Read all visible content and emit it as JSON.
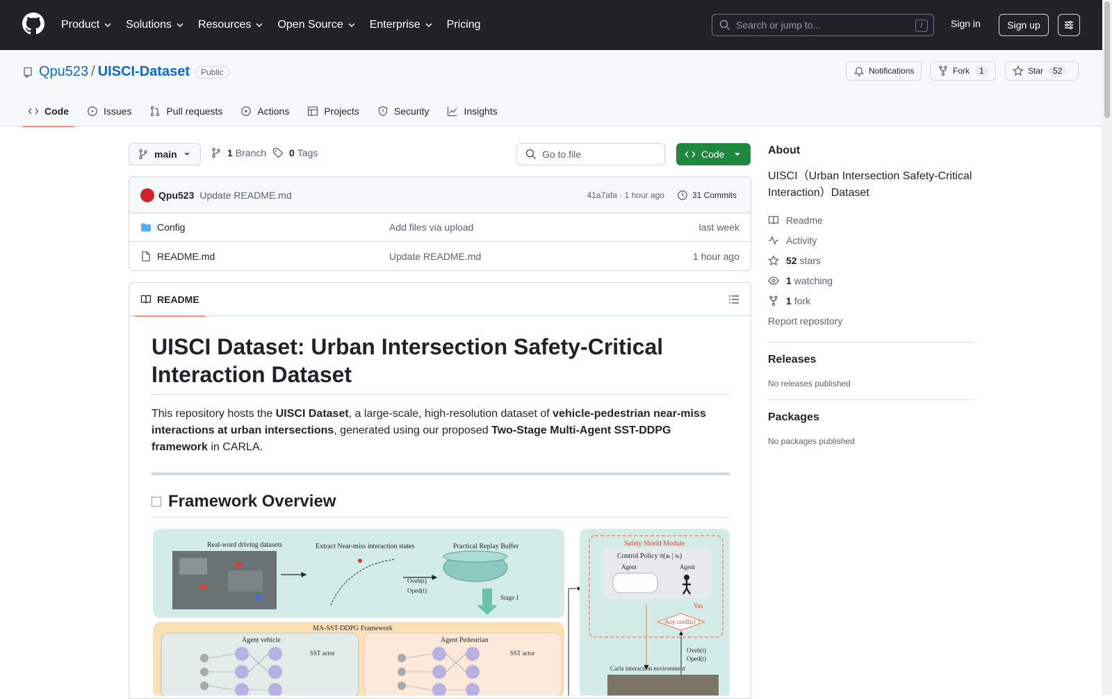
{
  "nav": {
    "items": [
      "Product",
      "Solutions",
      "Resources",
      "Open Source",
      "Enterprise",
      "Pricing"
    ],
    "search_placeholder": "Search or jump to...",
    "search_key": "/",
    "sign_in": "Sign in",
    "sign_up": "Sign up"
  },
  "repo": {
    "owner": "Qpu523",
    "sep": "/",
    "name": "UISCI-Dataset",
    "visibility": "Public",
    "notifications": "Notifications",
    "fork_label": "Fork",
    "fork_count": "1",
    "star_label": "Star",
    "star_count": "52"
  },
  "tabs": [
    "Code",
    "Issues",
    "Pull requests",
    "Actions",
    "Projects",
    "Security",
    "Insights"
  ],
  "toolbar": {
    "branch": "main",
    "branch_count": "1",
    "branch_label": "Branch",
    "tag_count": "0",
    "tag_label": "Tags",
    "goto_placeholder": "Go to file",
    "code_label": "Code"
  },
  "commit": {
    "author": "Qpu523",
    "message": "Update README.md",
    "hash_time": "41a7afa · 1 hour ago",
    "commits": "31 Commits"
  },
  "files": [
    {
      "name": "Config",
      "message": "Add files via upload",
      "date": "last week",
      "type": "folder"
    },
    {
      "name": "README.md",
      "message": "Update README.md",
      "date": "1 hour ago",
      "type": "file"
    }
  ],
  "readme": {
    "tab": "README",
    "title": "UISCI Dataset: Urban Intersection Safety-Critical Interaction Dataset",
    "p_1": "This repository hosts the ",
    "p_2": "UISCI Dataset",
    "p_3": ", a large-scale, high-resolution dataset of ",
    "p_4": "vehicle-pedestrian near-miss interactions at urban intersections",
    "p_5": ", generated using our proposed ",
    "p_6": "Two-Stage Multi-Agent SST-DDPG framework",
    "p_7": " in CARLA.",
    "h2": "Framework Overview",
    "fig": {
      "real_world": "Real-word driving datasets",
      "extract": "Extract Near-miss interaction states",
      "buffer": "Practical Replay Buffer",
      "stage1": "Stage 1",
      "framework": "MA-SST-DDPG Framework",
      "agent_vehicle": "Agent vehicle",
      "agent_ped": "Agent Pedestrian",
      "sst_actor": "SST actor",
      "shield": "Safety Shield Module",
      "policy": "Control Policy π(aₜ | sₜ)",
      "agent": "Agent",
      "conflict": "Any conflict ?",
      "yes": "Yes",
      "carla": "Carla interaction environment",
      "o_veh": "Oveh(t)",
      "o_ped": "Oped(t)"
    }
  },
  "about": {
    "heading": "About",
    "description": "UISCI（Urban Intersection Safety-Critical Interaction）Dataset",
    "readme": "Readme",
    "activity": "Activity",
    "stars_count": "52",
    "stars_label": "stars",
    "watching_count": "1",
    "watching_label": "watching",
    "fork_count": "1",
    "fork_label": "fork",
    "report": "Report repository"
  },
  "releases": {
    "heading": "Releases",
    "empty": "No releases published"
  },
  "packages": {
    "heading": "Packages",
    "empty": "No packages published"
  },
  "colors": {
    "accent": "#0969da",
    "green": "#1f883d",
    "tab_underline": "#fd8c73",
    "header_bg": "#1f2328"
  }
}
